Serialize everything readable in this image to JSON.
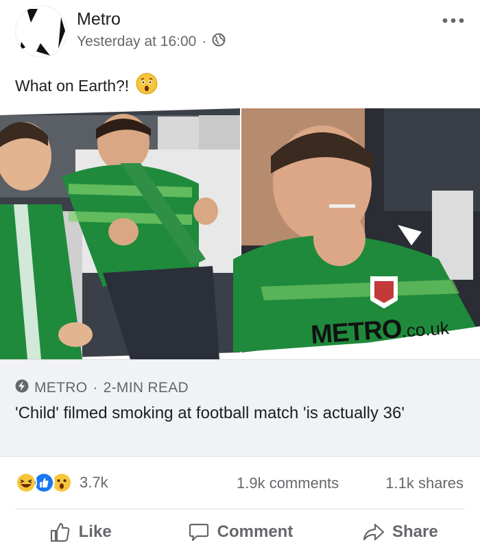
{
  "post": {
    "page_name": "Metro",
    "timestamp": "Yesterday at 16:00",
    "separator": "·",
    "privacy_icon": "globe-icon",
    "more_icon": "more-horizontal-icon",
    "text": "What on Earth?!",
    "text_emoji": "astonished-face-emoji"
  },
  "media": {
    "watermark_brand": "METRO",
    "watermark_domain": ".co.uk"
  },
  "link_preview": {
    "source_icon": "lightning-bolt-icon",
    "source": "METRO",
    "separator": "·",
    "read_time": "2-MIN READ",
    "title": "'Child' filmed smoking at football match 'is actually 36'"
  },
  "stats": {
    "reaction_icons": [
      "haha-reaction-icon",
      "like-reaction-icon",
      "wow-reaction-icon"
    ],
    "reaction_count": "3.7k",
    "comments": "1.9k comments",
    "shares": "1.1k shares"
  },
  "actions": {
    "like": "Like",
    "comment": "Comment",
    "share": "Share"
  },
  "colors": {
    "facebook_blue": "#1877f2",
    "secondary_text": "#65676b",
    "preview_bg": "#f0f2f5",
    "jersey_green": "#1f8a3c"
  }
}
